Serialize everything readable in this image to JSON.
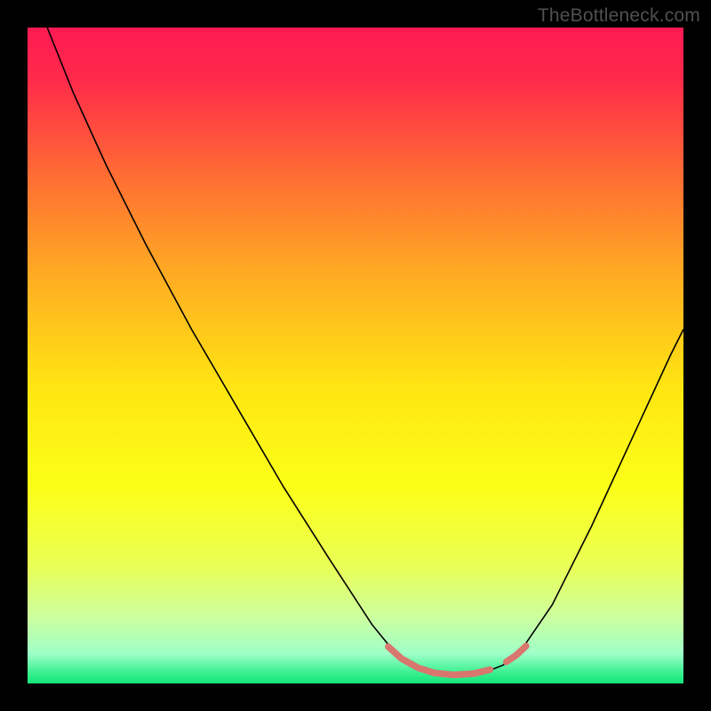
{
  "watermark": "TheBottleneck.com",
  "chart_data": {
    "type": "line",
    "title": "",
    "xlabel": "",
    "ylabel": "",
    "xlim": [
      0,
      100
    ],
    "ylim": [
      0,
      100
    ],
    "gradient_stops": [
      {
        "offset": 0.0,
        "color": "#ff1a53"
      },
      {
        "offset": 0.08,
        "color": "#ff2a4a"
      },
      {
        "offset": 0.22,
        "color": "#ff6a34"
      },
      {
        "offset": 0.38,
        "color": "#ffad22"
      },
      {
        "offset": 0.55,
        "color": "#ffe612"
      },
      {
        "offset": 0.7,
        "color": "#fbff17"
      },
      {
        "offset": 0.82,
        "color": "#eaff55"
      },
      {
        "offset": 0.9,
        "color": "#ccffa0"
      },
      {
        "offset": 0.955,
        "color": "#9effc8"
      },
      {
        "offset": 0.985,
        "color": "#35ef8e"
      },
      {
        "offset": 1.0,
        "color": "#15e67a"
      }
    ],
    "series": [
      {
        "name": "bottleneck-curve",
        "color": "#000000",
        "stroke_width": 1.6,
        "points": [
          {
            "x": 3.0,
            "y": 100.0
          },
          {
            "x": 7.0,
            "y": 90.0
          },
          {
            "x": 12.0,
            "y": 79.0
          },
          {
            "x": 18.0,
            "y": 67.0
          },
          {
            "x": 25.0,
            "y": 54.0
          },
          {
            "x": 32.0,
            "y": 42.0
          },
          {
            "x": 39.0,
            "y": 30.0
          },
          {
            "x": 46.0,
            "y": 19.0
          },
          {
            "x": 52.5,
            "y": 9.0
          },
          {
            "x": 56.0,
            "y": 4.7
          },
          {
            "x": 58.5,
            "y": 2.8
          },
          {
            "x": 61.0,
            "y": 1.8
          },
          {
            "x": 64.0,
            "y": 1.3
          },
          {
            "x": 67.0,
            "y": 1.3
          },
          {
            "x": 70.0,
            "y": 1.8
          },
          {
            "x": 72.5,
            "y": 2.8
          },
          {
            "x": 75.0,
            "y": 4.7
          },
          {
            "x": 80.0,
            "y": 12.0
          },
          {
            "x": 86.0,
            "y": 24.0
          },
          {
            "x": 92.0,
            "y": 37.0
          },
          {
            "x": 98.0,
            "y": 50.0
          },
          {
            "x": 100.0,
            "y": 54.0
          }
        ]
      },
      {
        "name": "highlight-left",
        "color": "#d9766e",
        "stroke_width": 7.5,
        "linecap": "round",
        "points": [
          {
            "x": 55.0,
            "y": 5.6
          },
          {
            "x": 57.0,
            "y": 3.8
          },
          {
            "x": 59.5,
            "y": 2.4
          },
          {
            "x": 62.0,
            "y": 1.6
          },
          {
            "x": 65.0,
            "y": 1.3
          },
          {
            "x": 68.0,
            "y": 1.5
          },
          {
            "x": 70.5,
            "y": 2.1
          }
        ]
      },
      {
        "name": "highlight-right",
        "color": "#d9766e",
        "stroke_width": 7.5,
        "linecap": "round",
        "points": [
          {
            "x": 73.0,
            "y": 3.3
          },
          {
            "x": 74.5,
            "y": 4.3
          },
          {
            "x": 76.0,
            "y": 5.7
          }
        ]
      }
    ]
  }
}
